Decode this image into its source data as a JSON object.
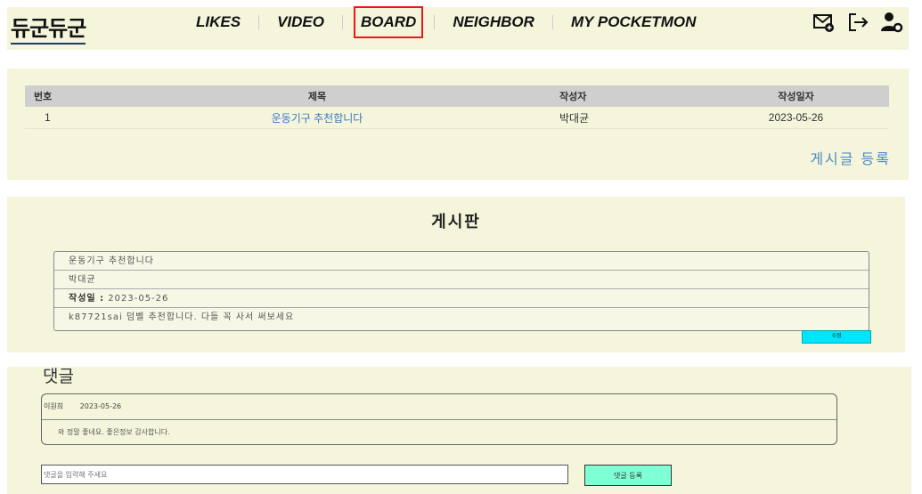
{
  "header": {
    "logo": "듀군듀군",
    "nav": [
      "LIKES",
      "VIDEO",
      "BOARD",
      "NEIGHBOR",
      "MY POCKETMON"
    ],
    "active_nav": "BOARD"
  },
  "board": {
    "columns": [
      "번호",
      "제목",
      "작성자",
      "작성일자"
    ],
    "rows": [
      {
        "no": "1",
        "title": "운동기구 추천합니다",
        "author": "박대균",
        "date": "2023-05-26"
      }
    ],
    "write_button": "게시글 등록"
  },
  "detail": {
    "heading": "게시판",
    "title": "운동기구 추천합니다",
    "author": "박대균",
    "date_label": "작성일 :",
    "date": "2023-05-26",
    "content": "k87721sai 덤벨 추천합니다. 다들 꼭 사서 써보세요",
    "edit_button": "수정"
  },
  "comments": {
    "heading": "댓글",
    "items": [
      {
        "author": "이원희",
        "date": "2023-05-26",
        "text": "와 정말 좋네요. 좋은정보 감사합니다."
      }
    ],
    "input_placeholder": "댓글을 입력해 주세요",
    "submit_button": "댓글 등록"
  }
}
